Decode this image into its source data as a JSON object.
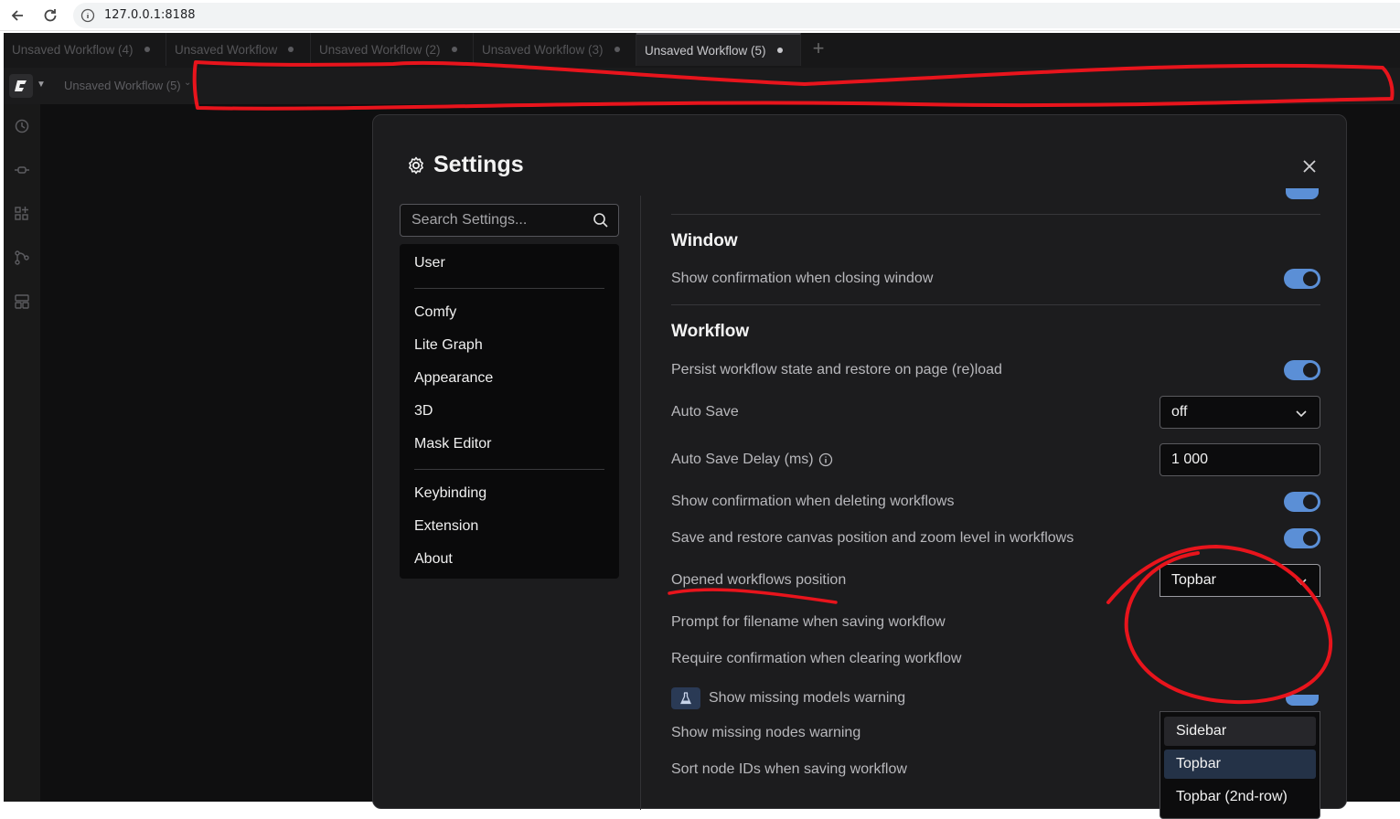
{
  "browser": {
    "url": "127.0.0.1:8188"
  },
  "workflow_tabs": [
    {
      "label": "Unsaved Workflow (4)"
    },
    {
      "label": "Unsaved Workflow"
    },
    {
      "label": "Unsaved Workflow (2)"
    },
    {
      "label": "Unsaved Workflow (3)"
    },
    {
      "label": "Unsaved Workflow (5)",
      "active": true
    }
  ],
  "toolbar": {
    "workflow_label": "Unsaved Workflow (5)"
  },
  "settings": {
    "title": "Settings",
    "search_placeholder": "Search Settings...",
    "categories": {
      "group1": [
        "User"
      ],
      "group2": [
        "Comfy",
        "Lite Graph",
        "Appearance",
        "3D",
        "Mask Editor"
      ],
      "group3": [
        "Keybinding",
        "Extension",
        "About"
      ]
    },
    "sections": {
      "window": {
        "title": "Window",
        "rows": [
          {
            "label": "Show confirmation when closing window",
            "type": "toggle",
            "value": true
          }
        ]
      },
      "workflow": {
        "title": "Workflow",
        "rows": [
          {
            "label": "Persist workflow state and restore on page (re)load",
            "type": "toggle",
            "value": true
          },
          {
            "label": "Auto Save",
            "type": "select",
            "value": "off"
          },
          {
            "label": "Auto Save Delay (ms)",
            "type": "number",
            "value": "1 000"
          },
          {
            "label": "Show confirmation when deleting workflows",
            "type": "toggle",
            "value": true
          },
          {
            "label": "Save and restore canvas position and zoom level in workflows",
            "type": "toggle",
            "value": true
          },
          {
            "label": "Opened workflows position",
            "type": "select",
            "value": "Topbar"
          },
          {
            "label": "Prompt for filename when saving workflow",
            "type": "toggle",
            "value": true
          },
          {
            "label": "Require confirmation when clearing workflow",
            "type": "toggle",
            "value": true
          },
          {
            "label": "Show missing models warning",
            "type": "toggle",
            "value": true,
            "experimental": true
          },
          {
            "label": "Show missing nodes warning",
            "type": "toggle",
            "value": true
          },
          {
            "label": "Sort node IDs when saving workflow",
            "type": "toggle",
            "value": false
          }
        ]
      }
    },
    "position_dropdown": {
      "options": [
        "Sidebar",
        "Topbar",
        "Topbar (2nd-row)"
      ],
      "selected": "Topbar",
      "hovered": "Sidebar"
    }
  },
  "colors": {
    "accent": "#5b8fd6",
    "annotation": "#e8141c",
    "dialog_bg": "#1c1c1e"
  }
}
